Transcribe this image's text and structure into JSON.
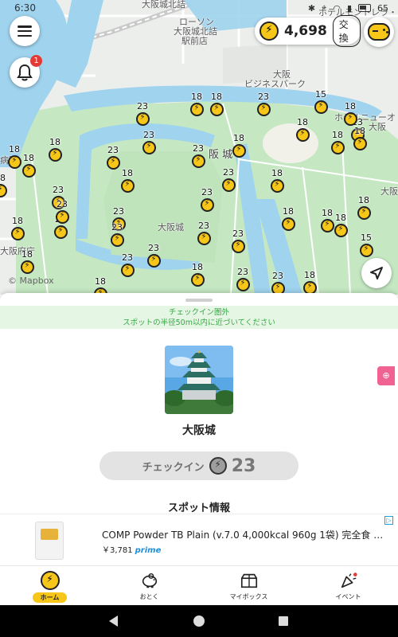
{
  "status_bar": {
    "time": "6:30",
    "battery": "65"
  },
  "map": {
    "labels": {
      "osaka_castle_north": "大阪城北詰",
      "lawson_1": "ローソン",
      "lawson_2": "大阪城北詰",
      "lawson_3": "駅前店",
      "osaka": "大阪",
      "business_park": "ビジネスパーク",
      "newotani_1": "ホテルニューオ",
      "newotani_2": "大阪",
      "osaka_castle_main": "阪 城",
      "osaka_castle_small": "大阪城",
      "hospital": "病院",
      "prefecture": "大阪府庁",
      "osaka_right": "大阪",
      "hotel_top": "ホテルモントレラ・"
    },
    "pins": [
      18,
      18,
      23,
      15,
      18,
      18,
      18,
      23,
      23,
      18,
      18,
      23,
      18,
      23,
      23,
      18,
      23,
      23,
      23,
      23,
      18,
      18,
      18,
      18,
      23,
      23,
      23,
      18,
      23,
      18,
      18,
      15,
      18,
      23,
      18,
      23,
      23,
      23,
      18,
      18,
      18,
      23,
      18
    ],
    "attribution": "© Mapbox"
  },
  "header": {
    "coin_balance": "4,698",
    "exchange_label": "交換",
    "notification_count": "1"
  },
  "sheet": {
    "out_of_range_line1": "チェックイン圏外",
    "out_of_range_line2": "スポットの半径50m以内に近づいてください",
    "spot_name": "大阪城",
    "checkin_label": "チェックイン",
    "checkin_points": "23",
    "spot_info_title": "スポット情報",
    "zoom_icon": "zoom-in-icon"
  },
  "ad": {
    "title": "COMP Powder TB Plain (v.7.0 4,000kcal 960g 1袋) 完全食 プロ...",
    "price": "￥3,781",
    "prime": "prime"
  },
  "tabbar": {
    "home": "ホーム",
    "deals": "おとく",
    "mybox": "マイボックス",
    "events": "イベント"
  },
  "colors": {
    "coin_yellow": "#f6c619",
    "park_green": "#c5e8c2",
    "water_blue": "#9fd3ee",
    "banner_green": "#35a844"
  }
}
